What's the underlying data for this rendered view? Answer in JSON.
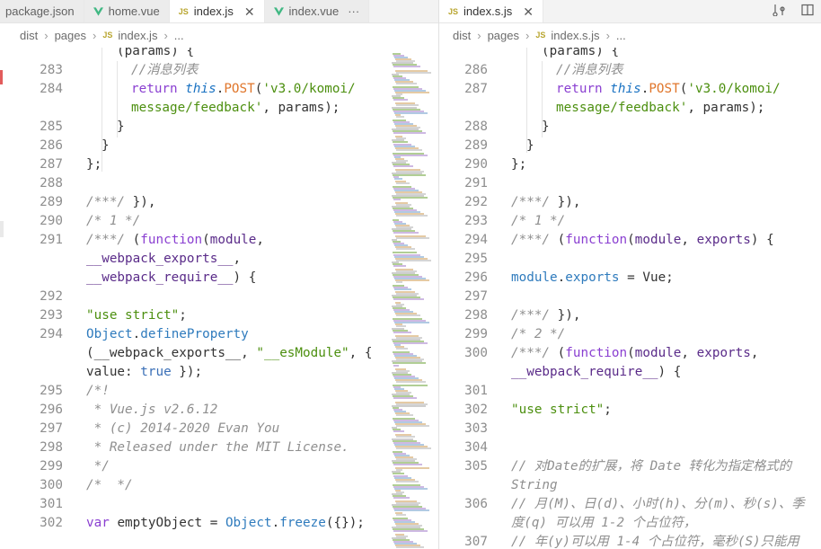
{
  "tabs_left": [
    {
      "label": "package.json",
      "kind": "json",
      "active": false
    },
    {
      "label": "home.vue",
      "kind": "vue",
      "active": false
    },
    {
      "label": "index.js",
      "kind": "js",
      "active": true
    },
    {
      "label": "index.vue",
      "kind": "vue",
      "active": false
    }
  ],
  "tabs_right": [
    {
      "label": "index.s.js",
      "kind": "js",
      "active": true
    }
  ],
  "breadcrumb_left": {
    "parts": [
      "dist",
      "pages"
    ],
    "file": "index.js",
    "tail": "..."
  },
  "breadcrumb_right": {
    "parts": [
      "dist",
      "pages"
    ],
    "file": "index.s.js",
    "tail": "..."
  },
  "badges": {
    "js": "JS",
    "close": "✕",
    "more": "···",
    "sep": "›"
  },
  "colors": {
    "keyword": "#8a3fd1",
    "function": "#2f7bbd",
    "string": "#4c8f0f",
    "comment": "#8f8f8f",
    "this": "#1a72c2",
    "post": "#e0762b",
    "vue": "#41b883"
  },
  "left_code": [
    {
      "n": "",
      "i": 0,
      "t": [
        {
          "c": "",
          "s": "(params) {"
        }
      ]
    },
    {
      "n": "283",
      "i": 0,
      "t": [
        {
          "c": "cm",
          "s": "//消息列表"
        }
      ]
    },
    {
      "n": "284",
      "i": 0,
      "t": [
        {
          "c": "kw",
          "s": "return "
        },
        {
          "c": "th",
          "s": "this"
        },
        {
          "c": "",
          "s": "."
        },
        {
          "c": "post",
          "s": "POST"
        },
        {
          "c": "",
          "s": "("
        },
        {
          "c": "str",
          "s": "'v3.0/komoi/"
        }
      ]
    },
    {
      "n": "",
      "i": 0,
      "t": [
        {
          "c": "str",
          "s": "message/feedback'"
        },
        {
          "c": "",
          "s": ", params);"
        }
      ]
    },
    {
      "n": "285",
      "i": 0,
      "t": [
        {
          "c": "",
          "s": "}"
        }
      ]
    },
    {
      "n": "286",
      "i": 0,
      "t": [
        {
          "c": "",
          "s": "}"
        }
      ]
    },
    {
      "n": "287",
      "i": 0,
      "t": [
        {
          "c": "",
          "s": "};"
        }
      ]
    },
    {
      "n": "288",
      "i": 0,
      "t": []
    },
    {
      "n": "289",
      "i": 0,
      "t": [
        {
          "c": "cm",
          "s": "/***/ "
        },
        {
          "c": "",
          "s": "}),"
        }
      ]
    },
    {
      "n": "290",
      "i": 0,
      "t": [
        {
          "c": "cm",
          "s": "/* 1 */"
        }
      ]
    },
    {
      "n": "291",
      "i": 0,
      "t": [
        {
          "c": "cm",
          "s": "/***/ "
        },
        {
          "c": "",
          "s": "("
        },
        {
          "c": "kw",
          "s": "function"
        },
        {
          "c": "",
          "s": "("
        },
        {
          "c": "nm",
          "s": "module"
        },
        {
          "c": "",
          "s": ","
        }
      ]
    },
    {
      "n": "",
      "i": 0,
      "t": [
        {
          "c": "nm",
          "s": "__webpack_exports__"
        },
        {
          "c": "",
          "s": ","
        }
      ]
    },
    {
      "n": "",
      "i": 0,
      "t": [
        {
          "c": "nm",
          "s": "__webpack_require__"
        },
        {
          "c": "",
          "s": ") {"
        }
      ]
    },
    {
      "n": "292",
      "i": 0,
      "t": []
    },
    {
      "n": "293",
      "i": 0,
      "t": [
        {
          "c": "str",
          "s": "\"use strict\""
        },
        {
          "c": "",
          "s": ";"
        }
      ]
    },
    {
      "n": "294",
      "i": 0,
      "t": [
        {
          "c": "fn",
          "s": "Object"
        },
        {
          "c": "",
          "s": "."
        },
        {
          "c": "fn",
          "s": "defineProperty"
        }
      ]
    },
    {
      "n": "",
      "i": 0,
      "t": [
        {
          "c": "",
          "s": "(__webpack_exports__, "
        },
        {
          "c": "str",
          "s": "\"__esModule\""
        },
        {
          "c": "",
          "s": ", {"
        }
      ]
    },
    {
      "n": "",
      "i": 0,
      "t": [
        {
          "c": "",
          "s": "value: "
        },
        {
          "c": "val",
          "s": "true"
        },
        {
          "c": "",
          "s": " });"
        }
      ]
    },
    {
      "n": "295",
      "i": 0,
      "t": [
        {
          "c": "cm",
          "s": "/*!"
        }
      ]
    },
    {
      "n": "296",
      "i": 0,
      "t": [
        {
          "c": "cm",
          "s": " * Vue.js v2.6.12"
        }
      ]
    },
    {
      "n": "297",
      "i": 0,
      "t": [
        {
          "c": "cm",
          "s": " * (c) 2014-2020 Evan You"
        }
      ]
    },
    {
      "n": "298",
      "i": 0,
      "t": [
        {
          "c": "cm",
          "s": " * Released under the MIT License."
        }
      ]
    },
    {
      "n": "299",
      "i": 0,
      "t": [
        {
          "c": "cm",
          "s": " */"
        }
      ]
    },
    {
      "n": "300",
      "i": 0,
      "t": [
        {
          "c": "cm",
          "s": "/*  */"
        }
      ]
    },
    {
      "n": "301",
      "i": 0,
      "t": []
    },
    {
      "n": "302",
      "i": 0,
      "t": [
        {
          "c": "kw",
          "s": "var "
        },
        {
          "c": "",
          "s": "emptyObject = "
        },
        {
          "c": "fn",
          "s": "Object"
        },
        {
          "c": "",
          "s": "."
        },
        {
          "c": "fn",
          "s": "freeze"
        },
        {
          "c": "",
          "s": "({});"
        }
      ]
    }
  ],
  "right_code": [
    {
      "n": "",
      "t": [
        {
          "c": "",
          "s": "(params) {"
        }
      ]
    },
    {
      "n": "286",
      "t": [
        {
          "c": "cm",
          "s": "//消息列表"
        }
      ]
    },
    {
      "n": "287",
      "t": [
        {
          "c": "kw",
          "s": "return "
        },
        {
          "c": "th",
          "s": "this"
        },
        {
          "c": "",
          "s": "."
        },
        {
          "c": "post",
          "s": "POST"
        },
        {
          "c": "",
          "s": "("
        },
        {
          "c": "str",
          "s": "'v3.0/komoi/"
        }
      ]
    },
    {
      "n": "",
      "t": [
        {
          "c": "str",
          "s": "message/feedback'"
        },
        {
          "c": "",
          "s": ", params);"
        }
      ]
    },
    {
      "n": "288",
      "t": [
        {
          "c": "",
          "s": "}"
        }
      ]
    },
    {
      "n": "289",
      "t": [
        {
          "c": "",
          "s": "}"
        }
      ]
    },
    {
      "n": "290",
      "t": [
        {
          "c": "",
          "s": "};"
        }
      ]
    },
    {
      "n": "291",
      "t": []
    },
    {
      "n": "292",
      "t": [
        {
          "c": "cm",
          "s": "/***/ "
        },
        {
          "c": "",
          "s": "}),"
        }
      ]
    },
    {
      "n": "293",
      "t": [
        {
          "c": "cm",
          "s": "/* 1 */"
        }
      ]
    },
    {
      "n": "294",
      "t": [
        {
          "c": "cm",
          "s": "/***/ "
        },
        {
          "c": "",
          "s": "("
        },
        {
          "c": "kw",
          "s": "function"
        },
        {
          "c": "",
          "s": "("
        },
        {
          "c": "nm",
          "s": "module"
        },
        {
          "c": "",
          "s": ", "
        },
        {
          "c": "nm",
          "s": "exports"
        },
        {
          "c": "",
          "s": ") {"
        }
      ]
    },
    {
      "n": "295",
      "t": []
    },
    {
      "n": "296",
      "t": [
        {
          "c": "fn",
          "s": "module"
        },
        {
          "c": "",
          "s": "."
        },
        {
          "c": "fn",
          "s": "exports"
        },
        {
          "c": "",
          "s": " = Vue;"
        }
      ]
    },
    {
      "n": "297",
      "t": []
    },
    {
      "n": "298",
      "t": [
        {
          "c": "cm",
          "s": "/***/ "
        },
        {
          "c": "",
          "s": "}),"
        }
      ]
    },
    {
      "n": "299",
      "t": [
        {
          "c": "cm",
          "s": "/* 2 */"
        }
      ]
    },
    {
      "n": "300",
      "t": [
        {
          "c": "cm",
          "s": "/***/ "
        },
        {
          "c": "",
          "s": "("
        },
        {
          "c": "kw",
          "s": "function"
        },
        {
          "c": "",
          "s": "("
        },
        {
          "c": "nm",
          "s": "module"
        },
        {
          "c": "",
          "s": ", "
        },
        {
          "c": "nm",
          "s": "exports"
        },
        {
          "c": "",
          "s": ","
        }
      ]
    },
    {
      "n": "",
      "t": [
        {
          "c": "nm",
          "s": "__webpack_require__"
        },
        {
          "c": "",
          "s": ") {"
        }
      ]
    },
    {
      "n": "301",
      "t": []
    },
    {
      "n": "302",
      "t": [
        {
          "c": "str",
          "s": "\"use strict\""
        },
        {
          "c": "",
          "s": ";"
        }
      ]
    },
    {
      "n": "303",
      "t": []
    },
    {
      "n": "304",
      "t": []
    },
    {
      "n": "305",
      "t": [
        {
          "c": "cm",
          "s": "// 对Date的扩展，将 Date 转化为指定格式的"
        }
      ]
    },
    {
      "n": "",
      "t": [
        {
          "c": "cm",
          "s": "String"
        }
      ]
    },
    {
      "n": "306",
      "t": [
        {
          "c": "cm",
          "s": "// 月(M)、日(d)、小时(h)、分(m)、秒(s)、季"
        }
      ]
    },
    {
      "n": "",
      "t": [
        {
          "c": "cm",
          "s": "度(q) 可以用 1-2 个占位符，"
        }
      ]
    },
    {
      "n": "307",
      "t": [
        {
          "c": "cm",
          "s": "// 年(y)可以用 1-4 个占位符，毫秒(S)只能用"
        }
      ]
    }
  ]
}
